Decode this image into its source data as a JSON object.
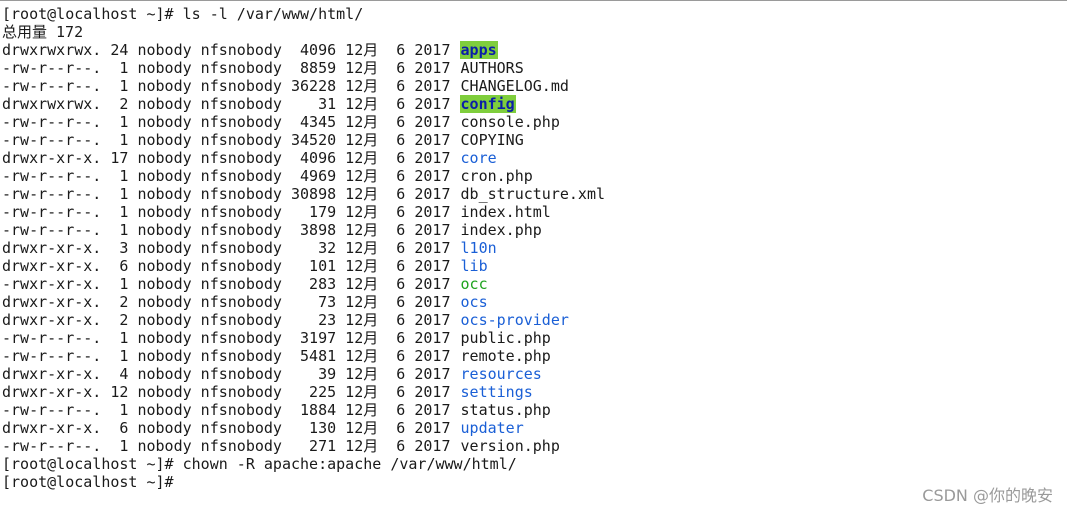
{
  "terminal": {
    "lines": [
      {
        "kind": "cmd",
        "text": "[root@localhost ~]# ls -l /var/www/html/"
      },
      {
        "kind": "text",
        "text": "总用量 172"
      },
      {
        "kind": "entry",
        "meta": "drwxrwxrwx. 24 nobody nfsnobody  4096 12月  6 2017 ",
        "name": "apps",
        "style": "hl"
      },
      {
        "kind": "entry",
        "meta": "-rw-r--r--.  1 nobody nfsnobody  8859 12月  6 2017 ",
        "name": "AUTHORS",
        "style": "plain"
      },
      {
        "kind": "entry",
        "meta": "-rw-r--r--.  1 nobody nfsnobody 36228 12月  6 2017 ",
        "name": "CHANGELOG.md",
        "style": "plain"
      },
      {
        "kind": "entry",
        "meta": "drwxrwxrwx.  2 nobody nfsnobody    31 12月  6 2017 ",
        "name": "config",
        "style": "hl"
      },
      {
        "kind": "entry",
        "meta": "-rw-r--r--.  1 nobody nfsnobody  4345 12月  6 2017 ",
        "name": "console.php",
        "style": "plain"
      },
      {
        "kind": "entry",
        "meta": "-rw-r--r--.  1 nobody nfsnobody 34520 12月  6 2017 ",
        "name": "COPYING",
        "style": "plain"
      },
      {
        "kind": "entry",
        "meta": "drwxr-xr-x. 17 nobody nfsnobody  4096 12月  6 2017 ",
        "name": "core",
        "style": "dir"
      },
      {
        "kind": "entry",
        "meta": "-rw-r--r--.  1 nobody nfsnobody  4969 12月  6 2017 ",
        "name": "cron.php",
        "style": "plain"
      },
      {
        "kind": "entry",
        "meta": "-rw-r--r--.  1 nobody nfsnobody 30898 12月  6 2017 ",
        "name": "db_structure.xml",
        "style": "plain"
      },
      {
        "kind": "entry",
        "meta": "-rw-r--r--.  1 nobody nfsnobody   179 12月  6 2017 ",
        "name": "index.html",
        "style": "plain"
      },
      {
        "kind": "entry",
        "meta": "-rw-r--r--.  1 nobody nfsnobody  3898 12月  6 2017 ",
        "name": "index.php",
        "style": "plain"
      },
      {
        "kind": "entry",
        "meta": "drwxr-xr-x.  3 nobody nfsnobody    32 12月  6 2017 ",
        "name": "l10n",
        "style": "dir"
      },
      {
        "kind": "entry",
        "meta": "drwxr-xr-x.  6 nobody nfsnobody   101 12月  6 2017 ",
        "name": "lib",
        "style": "dir"
      },
      {
        "kind": "entry",
        "meta": "-rwxr-xr-x.  1 nobody nfsnobody   283 12月  6 2017 ",
        "name": "occ",
        "style": "exec"
      },
      {
        "kind": "entry",
        "meta": "drwxr-xr-x.  2 nobody nfsnobody    73 12月  6 2017 ",
        "name": "ocs",
        "style": "dir"
      },
      {
        "kind": "entry",
        "meta": "drwxr-xr-x.  2 nobody nfsnobody    23 12月  6 2017 ",
        "name": "ocs-provider",
        "style": "dir"
      },
      {
        "kind": "entry",
        "meta": "-rw-r--r--.  1 nobody nfsnobody  3197 12月  6 2017 ",
        "name": "public.php",
        "style": "plain"
      },
      {
        "kind": "entry",
        "meta": "-rw-r--r--.  1 nobody nfsnobody  5481 12月  6 2017 ",
        "name": "remote.php",
        "style": "plain"
      },
      {
        "kind": "entry",
        "meta": "drwxr-xr-x.  4 nobody nfsnobody    39 12月  6 2017 ",
        "name": "resources",
        "style": "dir"
      },
      {
        "kind": "entry",
        "meta": "drwxr-xr-x. 12 nobody nfsnobody   225 12月  6 2017 ",
        "name": "settings",
        "style": "dir"
      },
      {
        "kind": "entry",
        "meta": "-rw-r--r--.  1 nobody nfsnobody  1884 12月  6 2017 ",
        "name": "status.php",
        "style": "plain"
      },
      {
        "kind": "entry",
        "meta": "drwxr-xr-x.  6 nobody nfsnobody   130 12月  6 2017 ",
        "name": "updater",
        "style": "dir"
      },
      {
        "kind": "entry",
        "meta": "-rw-r--r--.  1 nobody nfsnobody   271 12月  6 2017 ",
        "name": "version.php",
        "style": "plain"
      },
      {
        "kind": "cmd",
        "text": "[root@localhost ~]# chown -R apache:apache /var/www/html/"
      },
      {
        "kind": "prompt",
        "text": "[root@localhost ~]# "
      }
    ]
  },
  "watermark": "CSDN @你的晚安",
  "colors": {
    "background": "#ffffff",
    "text": "#1a1a1a",
    "directory": "#1a5fd6",
    "executable": "#1fa31f",
    "highlight_bg": "#7fce3c",
    "highlight_fg": "#0b1ea8"
  }
}
